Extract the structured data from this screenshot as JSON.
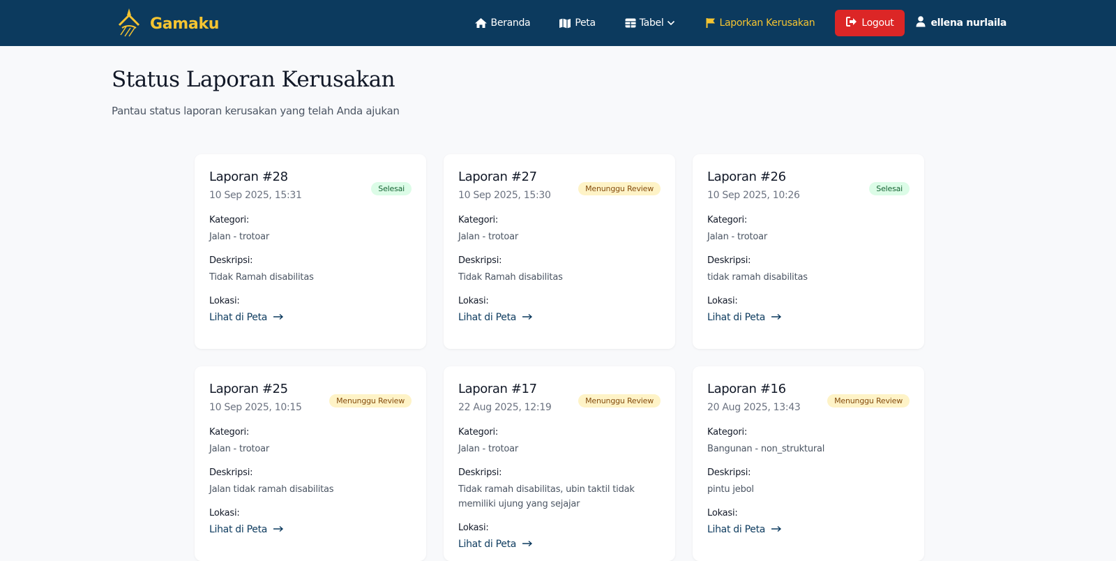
{
  "brand": {
    "name": "Gamaku"
  },
  "nav": {
    "home": "Beranda",
    "map": "Peta",
    "table": "Tabel",
    "report": "Laporkan Kerusakan",
    "logout": "Logout",
    "user": "ellena nurlaila"
  },
  "colors": {
    "navbar": "#0c3a5e",
    "accent": "#f5c431",
    "logout": "#dc2626",
    "done_bg": "#dcfce7",
    "review_bg": "#fef3c7"
  },
  "page": {
    "title": "Status Laporan Kerusakan",
    "subtitle": "Pantau status laporan kerusakan yang telah Anda ajukan"
  },
  "labels": {
    "category": "Kategori:",
    "description": "Deskripsi:",
    "location": "Lokasi:",
    "map_link": "Lihat di Peta"
  },
  "reports": [
    {
      "title": "Laporan #28",
      "date": "10 Sep 2025, 15:31",
      "status": "Selesai",
      "status_type": "done",
      "category": "Jalan - trotoar",
      "description": "Tidak Ramah disabilitas"
    },
    {
      "title": "Laporan #27",
      "date": "10 Sep 2025, 15:30",
      "status": "Menunggu Review",
      "status_type": "review",
      "category": "Jalan - trotoar",
      "description": "Tidak Ramah disabilitas"
    },
    {
      "title": "Laporan #26",
      "date": "10 Sep 2025, 10:26",
      "status": "Selesai",
      "status_type": "done",
      "category": "Jalan - trotoar",
      "description": "tidak ramah disabilitas"
    },
    {
      "title": "Laporan #25",
      "date": "10 Sep 2025, 10:15",
      "status": "Menunggu Review",
      "status_type": "review",
      "category": "Jalan - trotoar",
      "description": "Jalan tidak ramah disabilitas"
    },
    {
      "title": "Laporan #17",
      "date": "22 Aug 2025, 12:19",
      "status": "Menunggu Review",
      "status_type": "review",
      "category": "Jalan - trotoar",
      "description": "Tidak ramah disabilitas, ubin taktil tidak memiliki ujung yang sejajar"
    },
    {
      "title": "Laporan #16",
      "date": "20 Aug 2025, 13:43",
      "status": "Menunggu Review",
      "status_type": "review",
      "category": "Bangunan - non_struktural",
      "description": "pintu jebol"
    }
  ]
}
